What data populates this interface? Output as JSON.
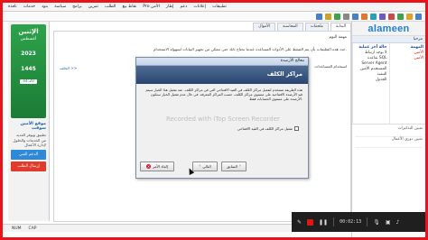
{
  "menubar": {
    "items": [
      "نافذة",
      "خدمات",
      "بنود",
      "سياسة",
      "برامج",
      "تمرين",
      "الطلب",
      "نقاط بيع",
      "الأمن Pro",
      "إطار",
      "دعم",
      "إعلانات",
      "تطبيقات"
    ]
  },
  "logo": {
    "text": "alameen"
  },
  "right_panel": {
    "header": "مرحبا",
    "col_right": {
      "title": "المهمة",
      "lines": [
        "الأمين",
        "الأمين"
      ]
    },
    "col_left": {
      "title": "حالة آخر عملية",
      "lines": [
        "لا يوجد ارتباط",
        "بقاعدة SQL",
        "Server Agent",
        "المستخدم الأمين",
        "التنفيذ",
        "الجدول"
      ]
    },
    "list": [
      "تعيين التذكيرات",
      "تعيين دوري الأعمال"
    ]
  },
  "left_panel": {
    "day": "الإثنين",
    "month": "أغسطس",
    "year": "2023",
    "hijri_year": "1445",
    "time": "44:20",
    "title": "موقع الأمين سوفت",
    "text": "تطبيق ويوفر العديد من الخدمات والحلول لإدارة الأعمال",
    "btn_primary": "الدعم الفني",
    "btn_secondary": "إرسال الطلب"
  },
  "tabs": [
    "البداية",
    "ملحقات",
    "المحاسبة",
    "الأموال"
  ],
  "main": {
    "crumb": "مهمة اليوم",
    "description": "حدد هذه التعليمات بأن يتم الضغط على الأدوات المساعدة عندما تحتاج ذلك حتى تتمكن من تجهيز البيانات لسهولة الاستخدام.",
    "sub": "استخدام المساعدات",
    "back_link": "الخلف >>"
  },
  "wizard": {
    "title": "معالج الأرصدة",
    "header": "مراكز الكلف",
    "body": "هذه الطريقة تستخدم لتفعيل مراكز الكلف في القيد الافتتاحي التي في مراكز الكلف.\nعند تفعيل هذا الخيار سيتم قيد الأرصدة الافتتاحية على مستوى مراكز الكلف، حسب المراكز المعرفة.\nفي حال عدم تفعيل الخيار ستكون الأرصدة على مستوى الحسابات فقط.",
    "checkbox_label": "تفعيل مراكز الكلف في القيد الافتتاحي",
    "watermark": "Recorded with iTop Screen Recorder",
    "cancel_label": "إلغاء الأمر",
    "back_label": "السابق",
    "next_label": "التالي"
  },
  "statusbar": {
    "items": [
      "NUM",
      "CAP"
    ]
  },
  "recorder": {
    "time": "00:02:13"
  }
}
